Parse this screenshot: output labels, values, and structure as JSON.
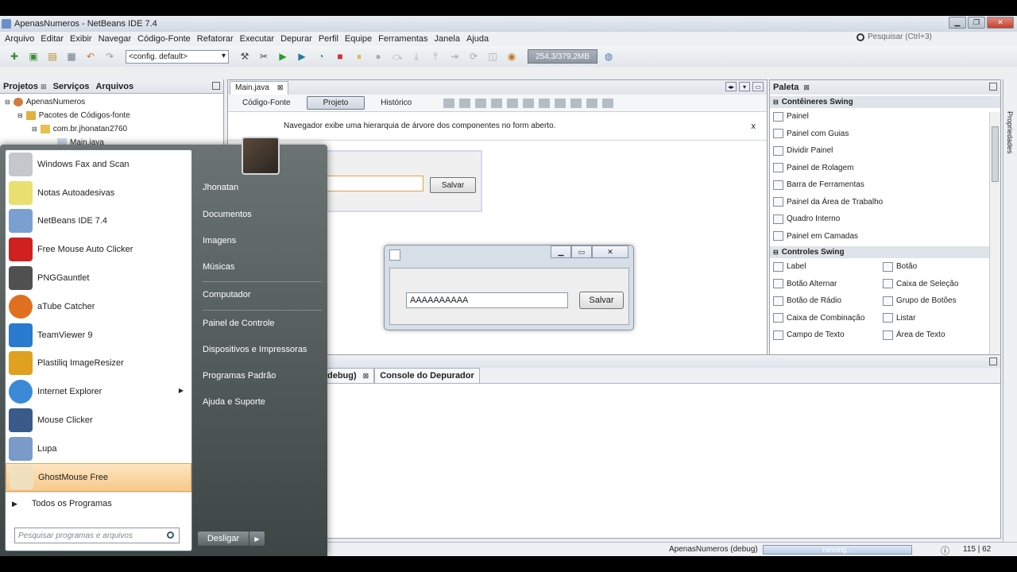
{
  "window": {
    "title": "ApenasNumeros - NetBeans IDE 7.4"
  },
  "menu": [
    "Arquivo",
    "Editar",
    "Exibir",
    "Navegar",
    "Código-Fonte",
    "Refatorar",
    "Executar",
    "Depurar",
    "Perfil",
    "Equipe",
    "Ferramentas",
    "Janela",
    "Ajuda"
  ],
  "search": {
    "placeholder": "Pesquisar (Ctrl+3)"
  },
  "toolbar": {
    "config": "<config. default>",
    "memory": "254,3/379,2MB"
  },
  "projects": {
    "tabs": [
      "Projetos",
      "Serviços",
      "Arquivos"
    ],
    "tree": [
      "ApenasNumeros",
      "Pacotes de Códigos-fonte",
      "com.br.jhonatan2760",
      "Main.java"
    ]
  },
  "editor": {
    "file_tab": "Main.java",
    "views": [
      "Código-Fonte",
      "Projeto",
      "Histórico"
    ],
    "info": "Navegador exibe uma hierarquia de árvore dos componentes no form aberto.",
    "info_close": "x",
    "design_button": "Salvar"
  },
  "preview": {
    "input_value": "AAAAAAAAAA",
    "button": "Salvar"
  },
  "output": {
    "tabs": [
      "debug)",
      "Console do Depurador"
    ]
  },
  "palette": {
    "title": "Paleta",
    "containers_label": "Contêineres Swing",
    "containers": [
      "Painel",
      "Painel com Guias",
      "Dividir Painel",
      "Painel de Rolagem",
      "Barra de Ferramentas",
      "Painel da Área de Trabalho",
      "Quadro Interno",
      "Painel em Camadas"
    ],
    "controls_label": "Controles Swing",
    "controls": [
      "Label",
      "Botão",
      "Botão Alternar",
      "Caixa de Seleção",
      "Botão de Rádio",
      "Grupo de Botões",
      "Caixa de Combinação",
      "Listar",
      "Campo de Texto",
      "Área de Texto"
    ]
  },
  "right_strip": {
    "label": "Propriedades"
  },
  "status": {
    "project": "ApenasNumeros (debug)",
    "progress": "running...",
    "position": "115 | 62"
  },
  "start_menu": {
    "programs": [
      "Windows Fax and Scan",
      "Notas Autoadesivas",
      "NetBeans IDE 7.4",
      "Free Mouse Auto Clicker",
      "PNGGauntlet",
      "aTube Catcher",
      "TeamViewer 9",
      "Plastiliq ImageResizer",
      "Internet Explorer",
      "Mouse Clicker",
      "Lupa",
      "GhostMouse Free"
    ],
    "all_programs": "Todos os Programas",
    "search_placeholder": "Pesquisar programas e arquivos",
    "links": [
      "Jhonatan",
      "Documentos",
      "Imagens",
      "Músicas",
      "Computador",
      "Painel de Controle",
      "Dispositivos e Impressoras",
      "Programas Padrão",
      "Ajuda e Suporte"
    ],
    "shutdown": "Desligar"
  }
}
